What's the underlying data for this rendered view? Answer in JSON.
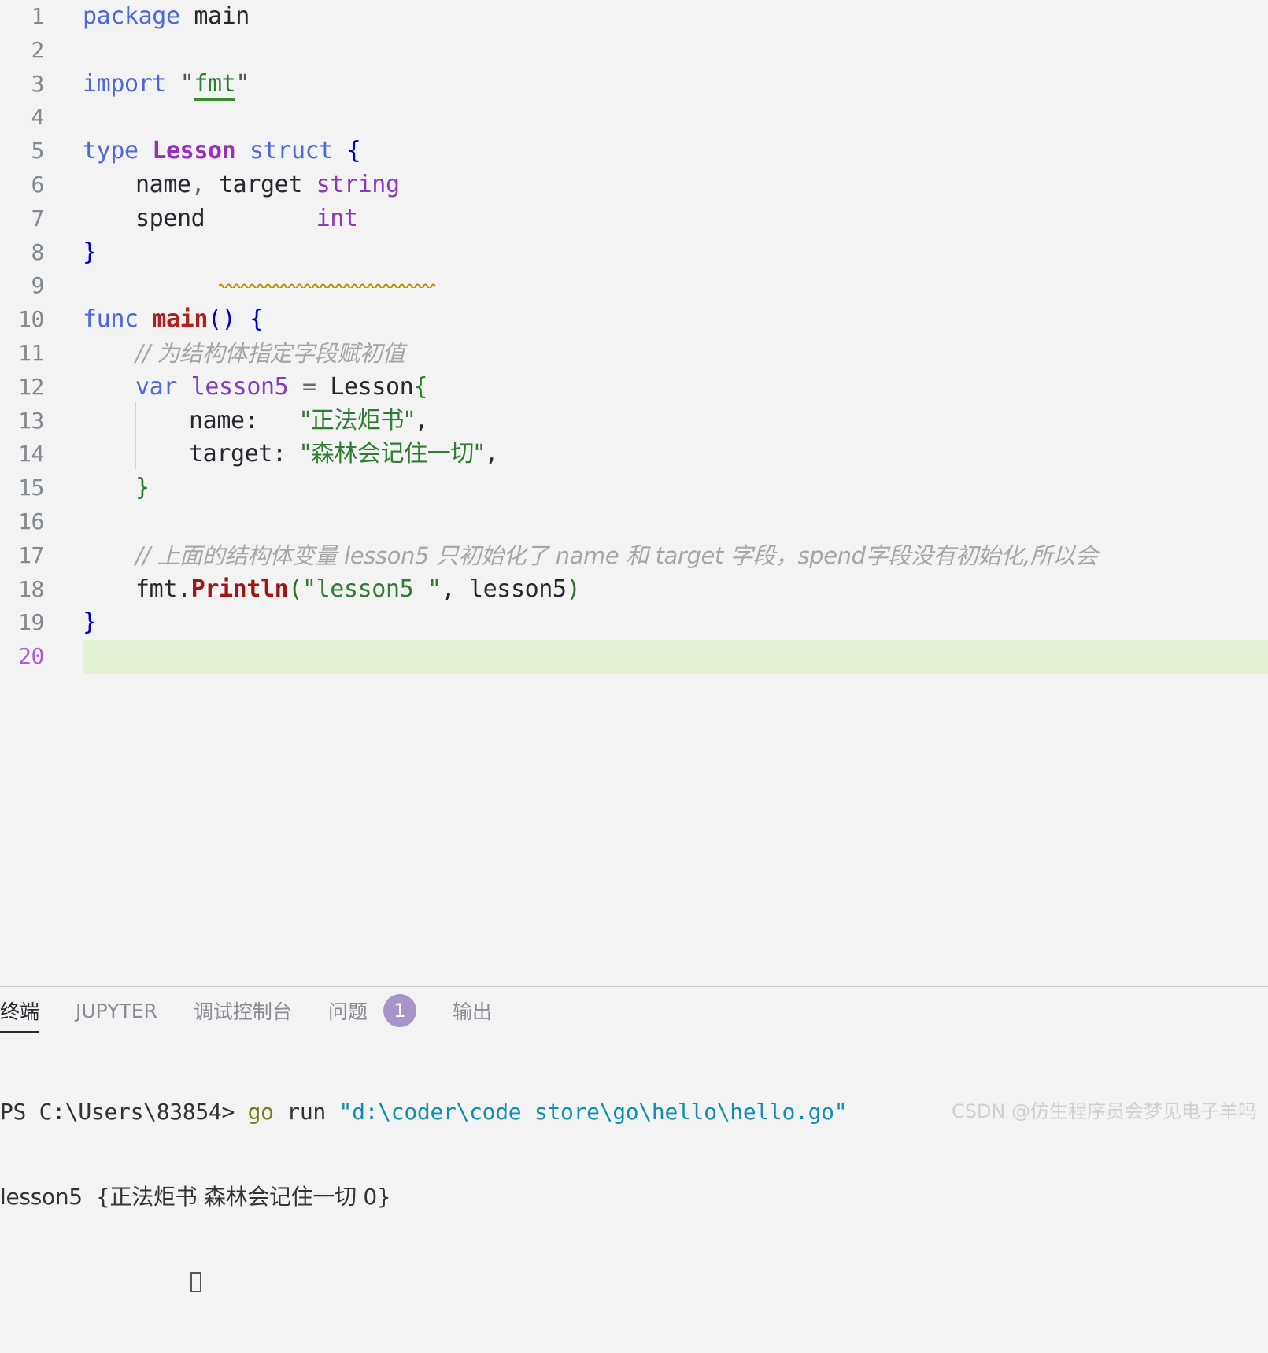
{
  "editor": {
    "language": "go",
    "active_line": 20,
    "background": "#f3f3f3",
    "active_line_background": "#e3f2d4",
    "line_number_color": "#818a8f",
    "active_line_number_color": "#a85fd6",
    "lines": [
      {
        "n": "1",
        "text": "package main"
      },
      {
        "n": "2",
        "text": ""
      },
      {
        "n": "3",
        "text": "import \"fmt\""
      },
      {
        "n": "4",
        "text": ""
      },
      {
        "n": "5",
        "text": "type Lesson struct {"
      },
      {
        "n": "6",
        "text": "    name, target string"
      },
      {
        "n": "7",
        "text": "    spend        int"
      },
      {
        "n": "8",
        "text": "}"
      },
      {
        "n": "9",
        "text": ""
      },
      {
        "n": "10",
        "text": "func main() {"
      },
      {
        "n": "11",
        "text": "    // 为结构体指定字段赋初值"
      },
      {
        "n": "12",
        "text": "    var lesson5 = Lesson{"
      },
      {
        "n": "13",
        "text": "        name:   \"正法炬书\","
      },
      {
        "n": "14",
        "text": "        target: \"森林会记住一切\","
      },
      {
        "n": "15",
        "text": "    }"
      },
      {
        "n": "16",
        "text": ""
      },
      {
        "n": "17",
        "text": "    // 上面的结构体变量 lesson5 只初始化了 name 和 target 字段，spend字段没有初始化,所以会"
      },
      {
        "n": "18",
        "text": "    fmt.Println(\"lesson5 \", lesson5)"
      },
      {
        "n": "19",
        "text": "}"
      },
      {
        "n": "20",
        "text": ""
      }
    ],
    "tokens": {
      "kw_package": "package",
      "kw_import": "import",
      "kw_type": "type",
      "kw_struct": "struct",
      "kw_func": "func",
      "kw_var": "var",
      "id_main_pkg": "main",
      "id_fmt_module": "fmt",
      "type_Lesson": "Lesson",
      "field_name": "name",
      "field_target": "target",
      "field_spend": "spend",
      "type_string": "string",
      "type_int": "int",
      "fn_main": "main",
      "fn_Println": "Println",
      "pkg_fmt": "fmt",
      "var_lesson5": "lesson5",
      "key_name": "name:",
      "key_target": "target:",
      "str_name_value": "\"正法炬书\"",
      "str_target_value": "\"森林会记住一切\"",
      "str_println_arg": "\"lesson5 \"",
      "comment_11": "// 为结构体指定字段赋初值",
      "comment_17": "// 上面的结构体变量 lesson5 只初始化了 name 和 target 字段，spend字段没有初始化,所以会"
    },
    "diagnostics": {
      "squiggle_line": "7",
      "squiggle_color": "#bf9000",
      "squiggle_target": "spend        int"
    },
    "link_underline": {
      "token": "fmt",
      "color": "#3a8b2f"
    }
  },
  "panel": {
    "tabs": [
      {
        "label": "终端",
        "active": true,
        "badge": null
      },
      {
        "label": "JUPYTER",
        "active": false,
        "badge": null
      },
      {
        "label": "调试控制台",
        "active": false,
        "badge": null
      },
      {
        "label": "问题",
        "active": false,
        "badge": "1"
      },
      {
        "label": "输出",
        "active": false,
        "badge": null
      }
    ],
    "badge_color": "#a694cb",
    "terminal": {
      "prompt": "PS C:\\Users\\83854>",
      "command": "go",
      "command_arg": "run",
      "command_path": "\"d:\\coder\\code store\\go\\hello\\hello.go\"",
      "output": "lesson5  {正法炬书 森林会记住一切 0}"
    }
  },
  "watermark": {
    "text": "CSDN @仿生程序员会梦见电子羊吗"
  }
}
